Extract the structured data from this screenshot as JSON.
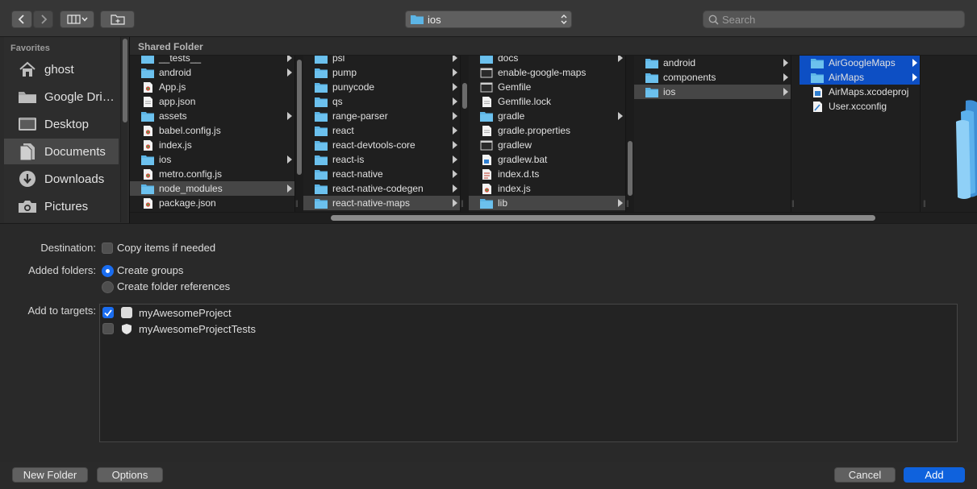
{
  "toolbar": {
    "back_icon": "chevron-left",
    "forward_icon": "chevron-right",
    "view_icon": "column-view",
    "new_folder_icon": "folder-plus",
    "path_label": "ios",
    "search_placeholder": "Search"
  },
  "sidebar": {
    "heading": "Favorites",
    "items": [
      {
        "label": "ghost",
        "icon": "home-icon"
      },
      {
        "label": "Google Dri…",
        "icon": "drive-icon"
      },
      {
        "label": "Desktop",
        "icon": "desktop-icon"
      },
      {
        "label": "Documents",
        "icon": "documents-icon",
        "selected": true
      },
      {
        "label": "Downloads",
        "icon": "downloads-icon"
      },
      {
        "label": "Pictures",
        "icon": "camera-icon"
      }
    ]
  },
  "browser": {
    "shared_label": "Shared Folder",
    "columns": [
      {
        "items": [
          {
            "label": "__tests__",
            "type": "folder",
            "arrow": true
          },
          {
            "label": "android",
            "type": "folder",
            "arrow": true
          },
          {
            "label": "App.js",
            "type": "js"
          },
          {
            "label": "app.json",
            "type": "doc"
          },
          {
            "label": "assets",
            "type": "folder",
            "arrow": true
          },
          {
            "label": "babel.config.js",
            "type": "js"
          },
          {
            "label": "index.js",
            "type": "js"
          },
          {
            "label": "ios",
            "type": "folder",
            "arrow": true
          },
          {
            "label": "metro.config.js",
            "type": "js"
          },
          {
            "label": "node_modules",
            "type": "folder",
            "arrow": true,
            "selected": "gray"
          },
          {
            "label": "package.json",
            "type": "js"
          }
        ]
      },
      {
        "items": [
          {
            "label": "psl",
            "type": "folder",
            "arrow": true
          },
          {
            "label": "pump",
            "type": "folder",
            "arrow": true
          },
          {
            "label": "punycode",
            "type": "folder",
            "arrow": true
          },
          {
            "label": "qs",
            "type": "folder",
            "arrow": true
          },
          {
            "label": "range-parser",
            "type": "folder",
            "arrow": true
          },
          {
            "label": "react",
            "type": "folder",
            "arrow": true
          },
          {
            "label": "react-devtools-core",
            "type": "folder",
            "arrow": true
          },
          {
            "label": "react-is",
            "type": "folder",
            "arrow": true
          },
          {
            "label": "react-native",
            "type": "folder",
            "arrow": true
          },
          {
            "label": "react-native-codegen",
            "type": "folder",
            "arrow": true
          },
          {
            "label": "react-native-maps",
            "type": "folder",
            "arrow": true,
            "selected": "gray"
          }
        ]
      },
      {
        "items": [
          {
            "label": "docs",
            "type": "folder",
            "arrow": true
          },
          {
            "label": "enable-google-maps",
            "type": "exec"
          },
          {
            "label": "Gemfile",
            "type": "exec"
          },
          {
            "label": "Gemfile.lock",
            "type": "doc"
          },
          {
            "label": "gradle",
            "type": "folder",
            "arrow": true
          },
          {
            "label": "gradle.properties",
            "type": "doc"
          },
          {
            "label": "gradlew",
            "type": "exec"
          },
          {
            "label": "gradlew.bat",
            "type": "bat"
          },
          {
            "label": "index.d.ts",
            "type": "ts"
          },
          {
            "label": "index.js",
            "type": "js"
          },
          {
            "label": "lib",
            "type": "folder",
            "arrow": true,
            "selected": "gray"
          }
        ]
      },
      {
        "items": [
          {
            "label": "android",
            "type": "folder",
            "arrow": true
          },
          {
            "label": "components",
            "type": "folder",
            "arrow": true
          },
          {
            "label": "ios",
            "type": "folder",
            "arrow": true,
            "selected": "gray"
          }
        ]
      },
      {
        "items": [
          {
            "label": "AirGoogleMaps",
            "type": "folder",
            "arrow": true,
            "selected": "blue"
          },
          {
            "label": "AirMaps",
            "type": "folder",
            "arrow": true,
            "selected": "blue"
          },
          {
            "label": "AirMaps.xcodeproj",
            "type": "xcodeproj"
          },
          {
            "label": "User.xcconfig",
            "type": "xcconfig"
          }
        ]
      }
    ]
  },
  "options": {
    "destination_label": "Destination:",
    "copy_items_label": "Copy items if needed",
    "copy_items_checked": false,
    "added_folders_label": "Added folders:",
    "create_groups_label": "Create groups",
    "create_folder_refs_label": "Create folder references",
    "selected_folder_option": "Create groups",
    "add_to_targets_label": "Add to targets:",
    "targets": [
      {
        "label": "myAwesomeProject",
        "checked": true,
        "icon": "app-target-icon"
      },
      {
        "label": "myAwesomeProjectTests",
        "checked": false,
        "icon": "test-target-icon"
      }
    ]
  },
  "footer": {
    "new_folder_label": "New Folder",
    "options_label": "Options",
    "cancel_label": "Cancel",
    "add_label": "Add"
  },
  "colors": {
    "accent": "#0f62dd",
    "folder": "#5cb5e6",
    "selection_blue": "#0d4fc4"
  }
}
